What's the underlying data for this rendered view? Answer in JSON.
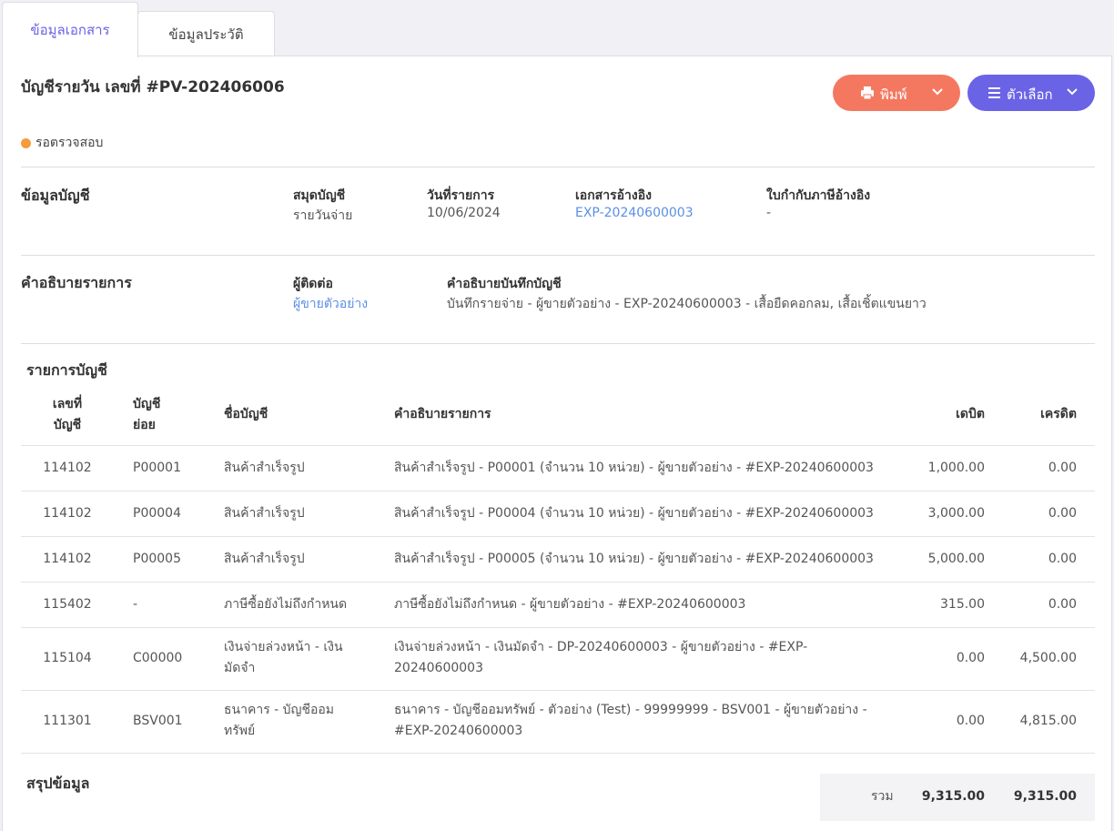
{
  "tabs": [
    {
      "label": "ข้อมูลเอกสาร",
      "active": true
    },
    {
      "label": "ข้อมูลประวัติ",
      "active": false
    }
  ],
  "document": {
    "title": "บัญชีรายวัน เลขที่ #PV-202406006",
    "status": "รอตรวจสอบ",
    "status_color": "#f59c3c"
  },
  "toolbar": {
    "print_label": "พิมพ์",
    "options_label": "ตัวเลือก",
    "print_color": "#f47860",
    "options_color": "#6b63e6"
  },
  "account_info": {
    "title": "ข้อมูลบัญชี",
    "fields": [
      {
        "label": "สมุดบัญชี",
        "value": "รายวันจ่าย"
      },
      {
        "label": "วันที่รายการ",
        "value": "10/06/2024"
      },
      {
        "label": "เอกสารอ้างอิง",
        "value": "EXP-20240600003"
      },
      {
        "label": "ใบกำกับภาษีอ้างอิง",
        "value": "-"
      }
    ]
  },
  "description": {
    "title": "คำอธิบายรายการ",
    "contact_label": "ผู้ติดต่อ",
    "contact_value": "ผู้ขายตัวอย่าง",
    "note_label": "คำอธิบายบันทึกบัญชี",
    "note_value": "บันทึกรายจ่าย - ผู้ขายตัวอย่าง - EXP-20240600003 - เสื้อยืดคอกลม, เสื้อเชิ้ตแขนยาว"
  },
  "entries": {
    "title": "รายการบัญชี",
    "headers": {
      "account_no_1": "เลขที่",
      "account_no_2": "บัญชี",
      "sub_1": "บัญชี",
      "sub_2": "ย่อย",
      "name": "ชื่อบัญชี",
      "desc": "คำอธิบายรายการ",
      "debit": "เดบิต",
      "credit": "เครดิต"
    },
    "rows": [
      {
        "no": "114102",
        "sub": "P00001",
        "name1": "สินค้าสำเร็จรูป",
        "name2": "",
        "desc1": "สินค้าสำเร็จรูป - P00001 (จำนวน 10 หน่วย) - ผู้ขายตัวอย่าง - #EXP-20240600003",
        "desc2": "",
        "debit": "1,000.00",
        "credit": "0.00"
      },
      {
        "no": "114102",
        "sub": "P00004",
        "name1": "สินค้าสำเร็จรูป",
        "name2": "",
        "desc1": "สินค้าสำเร็จรูป - P00004 (จำนวน 10 หน่วย) - ผู้ขายตัวอย่าง - #EXP-20240600003",
        "desc2": "",
        "debit": "3,000.00",
        "credit": "0.00"
      },
      {
        "no": "114102",
        "sub": "P00005",
        "name1": "สินค้าสำเร็จรูป",
        "name2": "",
        "desc1": "สินค้าสำเร็จรูป - P00005 (จำนวน 10 หน่วย) - ผู้ขายตัวอย่าง - #EXP-20240600003",
        "desc2": "",
        "debit": "5,000.00",
        "credit": "0.00"
      },
      {
        "no": "115402",
        "sub": "-",
        "name1": "ภาษีซื้อยังไม่ถึงกำหนด",
        "name2": "",
        "desc1": "ภาษีซื้อยังไม่ถึงกำหนด - ผู้ขายตัวอย่าง - #EXP-20240600003",
        "desc2": "",
        "debit": "315.00",
        "credit": "0.00"
      },
      {
        "no": "115104",
        "sub": "C00000",
        "name1": "เงินจ่ายล่วงหน้า - เงิน",
        "name2": "มัดจำ",
        "desc1": "เงินจ่ายล่วงหน้า - เงินมัดจำ - DP-20240600003 - ผู้ขายตัวอย่าง - #EXP-",
        "desc2": "20240600003",
        "debit": "0.00",
        "credit": "4,500.00"
      },
      {
        "no": "111301",
        "sub": "BSV001",
        "name1": "ธนาคาร - บัญชีออม",
        "name2": "ทรัพย์",
        "desc1": "ธนาคาร - บัญชีออมทรัพย์ - ตัวอย่าง (Test) - 99999999 - BSV001 - ผู้ขายตัวอย่าง -",
        "desc2": "#EXP-20240600003",
        "debit": "0.00",
        "credit": "4,815.00"
      }
    ]
  },
  "summary": {
    "title": "สรุปข้อมูล",
    "total_label": "รวม",
    "total_debit": "9,315.00",
    "total_credit": "9,315.00"
  }
}
